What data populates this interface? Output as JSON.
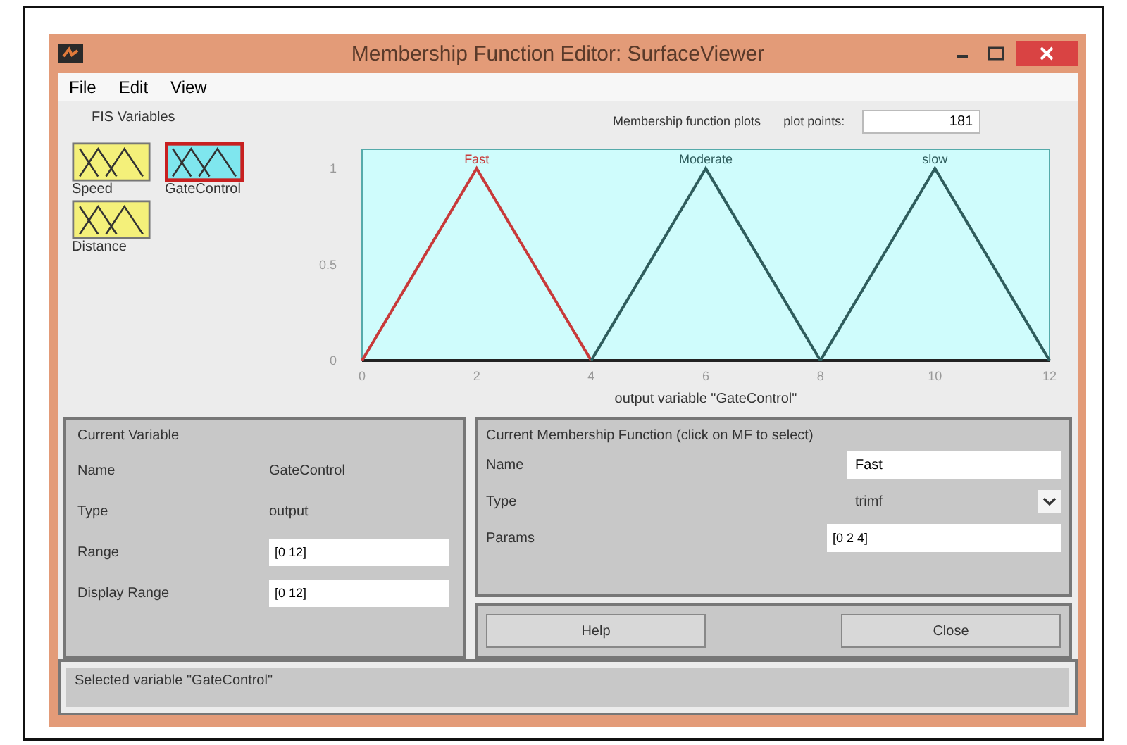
{
  "window": {
    "title": "Membership Function Editor: SurfaceViewer"
  },
  "menu": [
    "File",
    "Edit",
    "View"
  ],
  "fis_variables": {
    "title": "FIS Variables",
    "items": [
      {
        "label": "Speed",
        "kind": "input",
        "selected": false
      },
      {
        "label": "GateControl",
        "kind": "output",
        "selected": true
      },
      {
        "label": "Distance",
        "kind": "input",
        "selected": false
      }
    ]
  },
  "plot": {
    "title": "Membership function plots",
    "plot_points_label": "plot points:",
    "plot_points": "181",
    "chart_data": {
      "type": "line",
      "xlabel": "output variable \"GateControl\"",
      "x": [
        0,
        2,
        4,
        6,
        8,
        10,
        12
      ],
      "xlim": [
        0,
        12
      ],
      "ylim": [
        0,
        1.1
      ],
      "xticks": [
        0,
        2,
        4,
        6,
        8,
        10,
        12
      ],
      "yticks": [
        0,
        0.5,
        1
      ],
      "series": [
        {
          "name": "Fast",
          "color": "#c83a3a",
          "values": [
            0,
            1,
            0,
            null,
            null,
            null,
            null
          ]
        },
        {
          "name": "Moderate",
          "color": "#2f5d5d",
          "values": [
            null,
            null,
            0,
            1,
            0,
            null,
            null
          ]
        },
        {
          "name": "slow",
          "color": "#2f5d5d",
          "values": [
            null,
            null,
            null,
            null,
            0,
            1,
            0
          ]
        }
      ]
    }
  },
  "current_variable": {
    "title": "Current Variable",
    "name_label": "Name",
    "name": "GateControl",
    "type_label": "Type",
    "type": "output",
    "range_label": "Range",
    "range": "[0 12]",
    "display_range_label": "Display Range",
    "display_range": "[0 12]"
  },
  "current_mf": {
    "title": "Current Membership Function (click on MF to select)",
    "name_label": "Name",
    "name": "Fast",
    "type_label": "Type",
    "type": "trimf",
    "params_label": "Params",
    "params": "[0 2 4]"
  },
  "buttons": [
    "Help",
    "Close"
  ],
  "status": "Selected variable \"GateControl\""
}
